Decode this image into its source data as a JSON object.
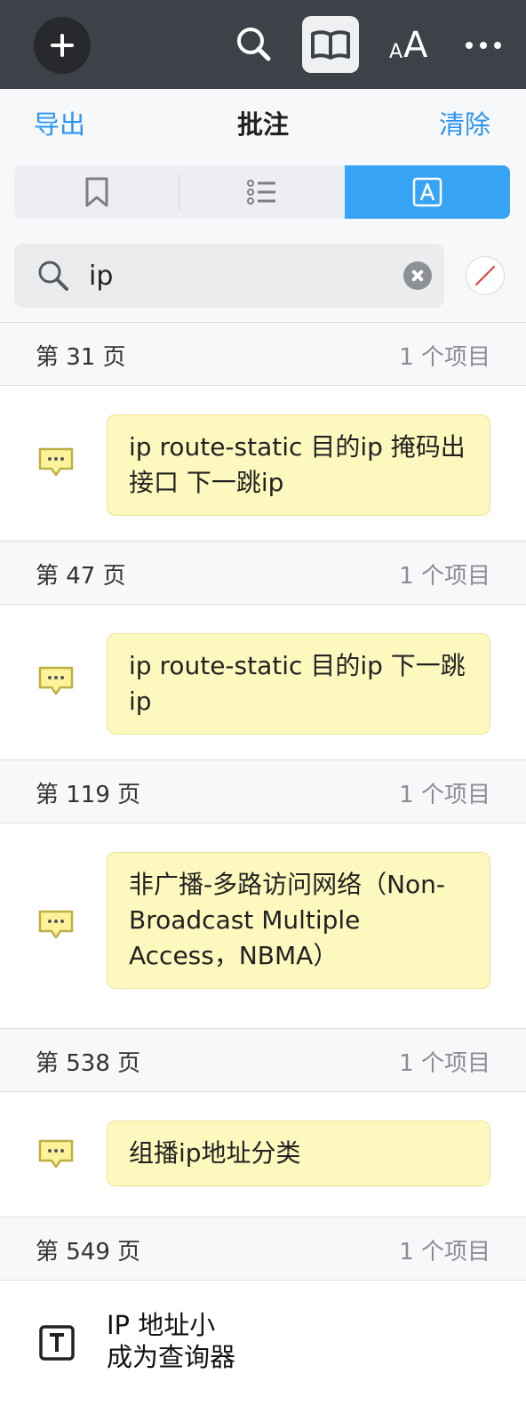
{
  "toolbar": {
    "font_small": "A",
    "font_big": "A"
  },
  "panel": {
    "export_label": "导出",
    "title": "批注",
    "clear_label": "清除"
  },
  "search": {
    "value": "ip"
  },
  "sections": [
    {
      "page": "第 31 页",
      "count": "1 个项目",
      "note": "ip route-static 目的ip 掩码出接口 下一跳ip"
    },
    {
      "page": "第 47 页",
      "count": "1 个项目",
      "note": "ip route-static 目的ip 下一跳ip"
    },
    {
      "page": "第 119 页",
      "count": "1 个项目",
      "note": "非广播-多路访问网络（Non-Broadcast Multiple Access，NBMA）"
    },
    {
      "page": "第 538 页",
      "count": "1 个项目",
      "note": "组播ip地址分类"
    },
    {
      "page": "第 549 页",
      "count": "1 个项目",
      "text_line1": "IP 地址小",
      "text_line2": "成为查询器"
    }
  ],
  "colors": {
    "toolbar_bg": "#3d4148",
    "accent": "#36a3f4",
    "note_bg": "#fdf8bd",
    "highlight_line": "#e23c3c"
  },
  "icons": [
    "plus-icon",
    "search-icon",
    "book-icon",
    "font-size-icon",
    "more-icon",
    "bookmark-icon",
    "list-icon",
    "annotation-icon",
    "note-icon",
    "text-icon"
  ]
}
